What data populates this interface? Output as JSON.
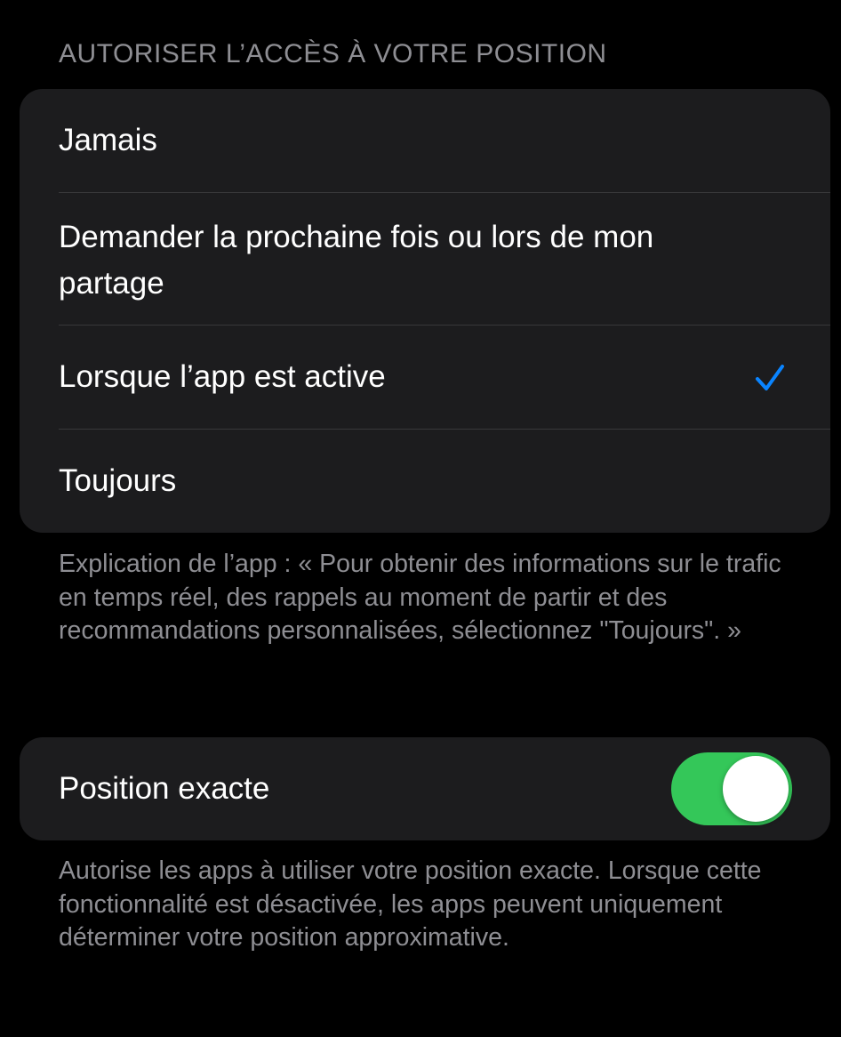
{
  "location_access": {
    "header": "AUTORISER L’ACCÈS À VOTRE POSITION",
    "options": [
      {
        "label": "Jamais",
        "selected": false
      },
      {
        "label": "Demander la prochaine fois ou lors de mon partage",
        "selected": false
      },
      {
        "label": "Lorsque l’app est active",
        "selected": true
      },
      {
        "label": "Toujours",
        "selected": false
      }
    ],
    "explanation": "Explication de l’app : « Pour obtenir des informations sur le trafic en temps réel, des rappels au moment de partir et des recommandations personnalisées, sélectionnez \"Toujours\". »"
  },
  "precise_location": {
    "label": "Position exacte",
    "enabled": true,
    "footer": "Autorise les apps à utiliser votre position exacte. Lorsque cette fonctionnalité est désactivée, les apps peuvent uniquement déterminer votre position approximative."
  },
  "colors": {
    "background": "#000000",
    "group_background": "#1c1c1e",
    "secondary_text": "#8e8e93",
    "checkmark": "#0a84ff",
    "toggle_on": "#34c759"
  },
  "icons": {
    "selected_marker": "checkmark-icon"
  }
}
